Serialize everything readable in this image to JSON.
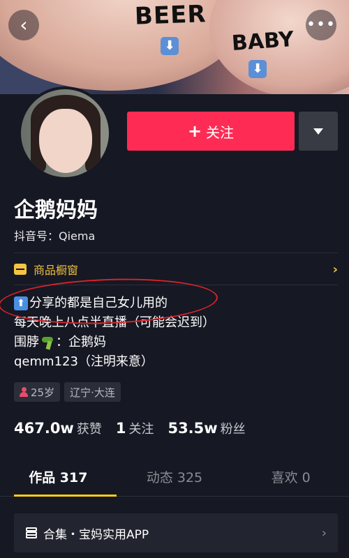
{
  "cover": {
    "text_beer": "BEER",
    "text_baby": "BABY",
    "arrow_glyph": "⬇"
  },
  "nav": {
    "back_icon": "chevron-left-icon",
    "back_glyph": "‹",
    "more_icon": "more-dots-icon",
    "more_glyph": "•••"
  },
  "profile": {
    "follow_label": "关注",
    "follow_plus": "+",
    "name": "企鹅妈妈",
    "douyin_id": "抖音号：Qiema"
  },
  "shop": {
    "label": "商品橱窗",
    "chevron": "›"
  },
  "bio": {
    "line1_icon": "⬆",
    "line1_text": "分享的都是自己女儿用的",
    "line2": "每天晚上八点半直播（可能会迟到）",
    "line3_prefix": "围脖",
    "line3_suffix": "：企鹅妈",
    "line4": "qemm123（注明来意）"
  },
  "tags": {
    "age": "25岁",
    "location": "辽宁·大连"
  },
  "stats": {
    "likes_value": "467.0w",
    "likes_label": "获赞",
    "following_value": "1",
    "following_label": "关注",
    "followers_value": "53.5w",
    "followers_label": "粉丝"
  },
  "tabs": [
    {
      "label": "作品 317",
      "active": true
    },
    {
      "label": "动态 325",
      "active": false
    },
    {
      "label": "喜欢 0",
      "active": false
    }
  ],
  "collection": {
    "label": "合集・宝妈实用APP",
    "chevron": "›"
  },
  "colors": {
    "background": "#161823",
    "follow": "#fe2c55",
    "shop_accent": "#f0c040",
    "tab_underline": "#face15",
    "annotation_circle": "#d8232a"
  }
}
